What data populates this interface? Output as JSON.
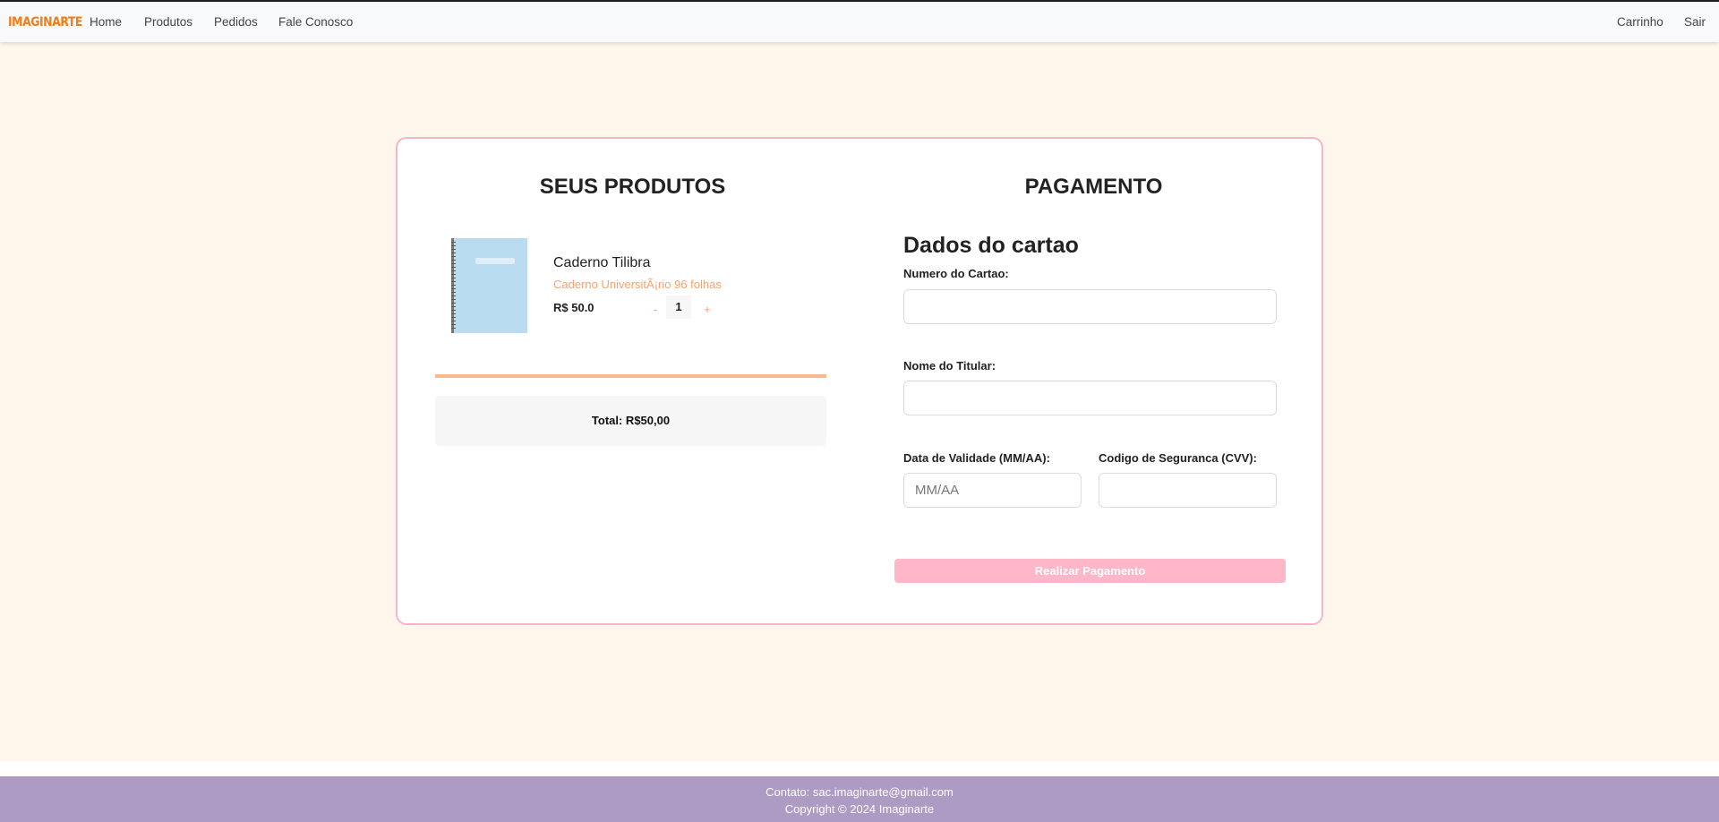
{
  "navbar": {
    "brand": "IMAGINARTE",
    "links": [
      "Home",
      "Produtos",
      "Pedidos",
      "Fale Conosco"
    ],
    "right_links": [
      "Carrinho",
      "Sair"
    ]
  },
  "products_section": {
    "title": "SEUS PRODUTOS",
    "items": [
      {
        "name": "Caderno Tilibra",
        "description": "Caderno UniversitÃ¡rio 96 folhas",
        "price": "R$ 50.0",
        "minus_label": "-",
        "quantity": "1",
        "plus_label": "+"
      }
    ],
    "total": "Total: R$50,00"
  },
  "payment_section": {
    "title": "PAGAMENTO",
    "subtitle": "Dados do cartao",
    "card_number_label": "Numero do Cartao:",
    "card_number_value": "",
    "holder_label": "Nome do Titular:",
    "holder_value": "",
    "expiry_label": "Data de Validade (MM/AA):",
    "expiry_placeholder": "MM/AA",
    "cvv_label": "Codigo de Seguranca (CVV):",
    "cvv_value": "",
    "submit_label": "Realizar Pagamento"
  },
  "footer": {
    "contact": "Contato: sac.imaginarte@gmail.com",
    "copyright": "Copyright © 2024 Imaginarte"
  },
  "colors": {
    "brand": "#f07d1a",
    "page_background": "#fff6ec",
    "card_border": "#f7b6c6",
    "accent_orange": "#f7a36c",
    "button_pink": "#ffb6c8",
    "footer_purple": "#ad9bc3"
  }
}
